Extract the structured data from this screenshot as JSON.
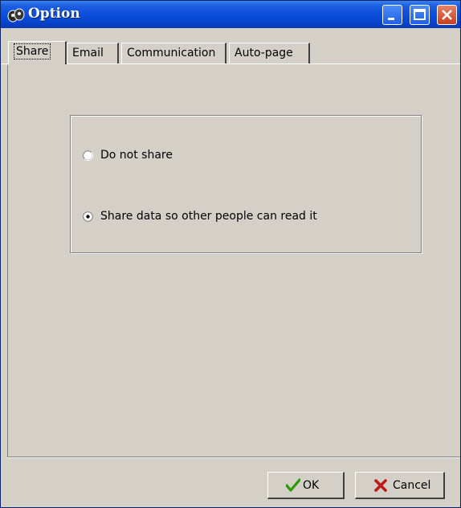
{
  "window": {
    "title": "Option",
    "icon": "app-icon",
    "controls": [
      "minimize-icon",
      "maximize-icon",
      "close-icon"
    ]
  },
  "tabs": [
    {
      "label": "Share",
      "active": true
    },
    {
      "label": "Email",
      "active": false
    },
    {
      "label": "Communication",
      "active": false
    },
    {
      "label": "Auto-page",
      "active": false
    }
  ],
  "share": {
    "options": [
      {
        "label": "Do not share",
        "selected": false
      },
      {
        "label": "Share data so other people can read it",
        "selected": true
      }
    ]
  },
  "buttons": {
    "ok": {
      "label": "OK",
      "icon": "checkmark-icon",
      "icon_color": "#2a9a00"
    },
    "cancel": {
      "label": "Cancel",
      "icon": "x-icon",
      "icon_color": "#c01818"
    }
  }
}
